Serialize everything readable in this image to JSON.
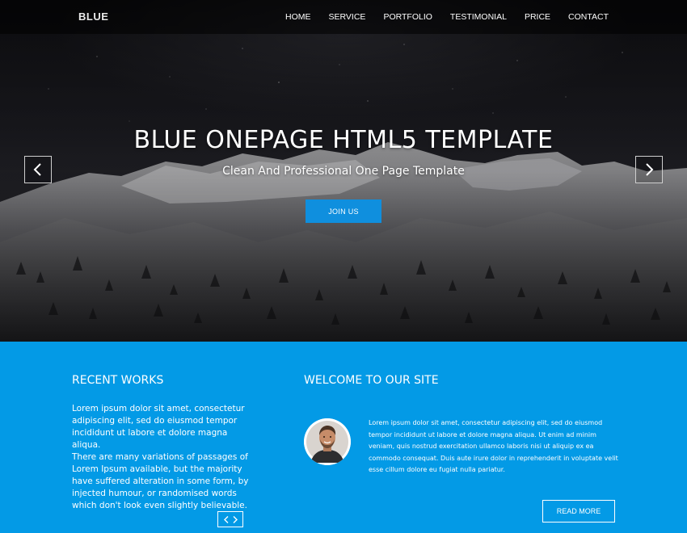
{
  "nav": {
    "brand": "BLUE",
    "items": [
      {
        "label": "HOME"
      },
      {
        "label": "SERVICE"
      },
      {
        "label": "PORTFOLIO"
      },
      {
        "label": "TESTIMONIAL"
      },
      {
        "label": "PRICE"
      },
      {
        "label": "CONTACT"
      }
    ]
  },
  "hero": {
    "title": "BLUE ONEPAGE HTML5 TEMPLATE",
    "subtitle": "Clean And Professional One Page Template",
    "cta_label": "JOIN US",
    "prev_icon": "chevron-left-icon",
    "next_icon": "chevron-right-icon"
  },
  "recent_works": {
    "heading": "RECENT WORKS",
    "paragraph1": "Lorem ipsum dolor sit amet, consectetur adipiscing elit, sed do eiusmod tempor incididunt ut labore et dolore magna aliqua.",
    "paragraph2": "There are many variations of passages of Lorem Ipsum available, but the majority have suffered alteration in some form, by injected humour, or randomised words which don't look even slightly believable.",
    "pager_icon": "chevron-left-right-icon"
  },
  "welcome": {
    "heading": "WELCOME TO OUR SITE",
    "text": "Lorem ipsum dolor sit amet, consectetur adipiscing elit, sed do eiusmod tempor incididunt ut labore et dolore magna aliqua. Ut enim ad minim veniam, quis nostrud exercitation ullamco laboris nisi ut aliquip ex ea commodo consequat. Duis aute irure dolor in reprehenderit in voluptate velit esse cillum dolore eu fugiat nulla pariatur.",
    "read_more_label": "READ MORE"
  },
  "colors": {
    "accent": "#039ae6",
    "button": "#0f8fde",
    "navbar": "#000000"
  }
}
